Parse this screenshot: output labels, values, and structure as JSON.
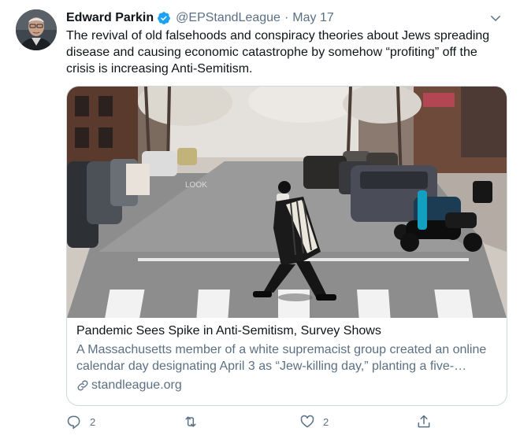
{
  "tweet": {
    "author_name": "Edward Parkin",
    "handle": "@EPStandLeague",
    "separator": "·",
    "date": "May 17",
    "text": "The revival of old falsehoods and conspiracy theories about Jews spreading disease and causing economic catastrophe by somehow “profiting” off the crisis is increasing Anti-Semitism."
  },
  "card": {
    "title": "Pandemic Sees Spike in Anti-Semitism, Survey Shows",
    "description": "A Massachusetts member of a white supremacist group created an online calendar day designating April 3 as “Jew-killing day,” planting a five-…",
    "domain": "standleague.org",
    "crosswalk_text": "LOOK"
  },
  "actions": {
    "reply_count": "2",
    "like_count": "2"
  },
  "icons": {
    "verified": "verified-badge-icon",
    "more": "chevron-down-icon",
    "link": "link-icon",
    "reply": "reply-icon",
    "retweet": "retweet-icon",
    "like": "heart-icon",
    "share": "share-icon"
  },
  "colors": {
    "accent": "#1da1f2",
    "secondary_text": "#5b7083",
    "border": "#cfd9de"
  }
}
